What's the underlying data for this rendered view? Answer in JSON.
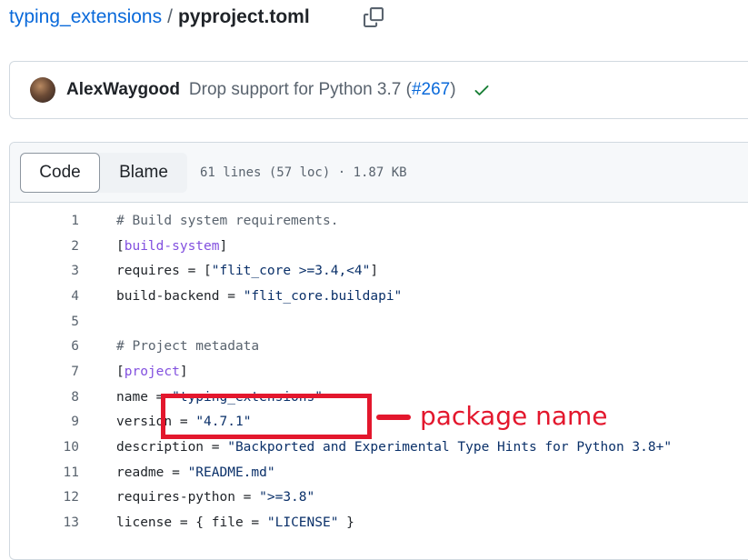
{
  "breadcrumb": {
    "repo": "typing_extensions",
    "separator": "/",
    "file": "pyproject.toml"
  },
  "commit": {
    "author": "AlexWaygood",
    "message": "Drop support for Python 3.7 (",
    "pr": "#267",
    "message_end": ")",
    "status_icon": "check-icon",
    "status_color": "#1a7f37"
  },
  "file_header": {
    "tab_code": "Code",
    "tab_blame": "Blame",
    "stats": "61 lines (57 loc) · 1.87 KB"
  },
  "code_lines": [
    {
      "num": "1",
      "parts": [
        {
          "t": "# Build system requirements.",
          "c": "cm"
        }
      ]
    },
    {
      "num": "2",
      "parts": [
        {
          "t": "[",
          "c": ""
        },
        {
          "t": "build-system",
          "c": "sec"
        },
        {
          "t": "]",
          "c": ""
        }
      ]
    },
    {
      "num": "3",
      "parts": [
        {
          "t": "requires = [",
          "c": ""
        },
        {
          "t": "\"flit_core >=3.4,<4\"",
          "c": "str"
        },
        {
          "t": "]",
          "c": ""
        }
      ]
    },
    {
      "num": "4",
      "parts": [
        {
          "t": "build-backend = ",
          "c": ""
        },
        {
          "t": "\"flit_core.buildapi\"",
          "c": "str"
        }
      ]
    },
    {
      "num": "5",
      "parts": []
    },
    {
      "num": "6",
      "parts": [
        {
          "t": "# Project metadata",
          "c": "cm"
        }
      ]
    },
    {
      "num": "7",
      "parts": [
        {
          "t": "[",
          "c": ""
        },
        {
          "t": "project",
          "c": "sec"
        },
        {
          "t": "]",
          "c": ""
        }
      ]
    },
    {
      "num": "8",
      "parts": [
        {
          "t": "name = ",
          "c": ""
        },
        {
          "t": "\"typing_extensions\"",
          "c": "str"
        }
      ]
    },
    {
      "num": "9",
      "parts": [
        {
          "t": "version = ",
          "c": ""
        },
        {
          "t": "\"4.7.1\"",
          "c": "str"
        }
      ]
    },
    {
      "num": "10",
      "parts": [
        {
          "t": "description = ",
          "c": ""
        },
        {
          "t": "\"Backported and Experimental Type Hints for Python 3.8+\"",
          "c": "str"
        }
      ]
    },
    {
      "num": "11",
      "parts": [
        {
          "t": "readme = ",
          "c": ""
        },
        {
          "t": "\"README.md\"",
          "c": "str"
        }
      ]
    },
    {
      "num": "12",
      "parts": [
        {
          "t": "requires-python = ",
          "c": ""
        },
        {
          "t": "\">=3.8\"",
          "c": "str"
        }
      ]
    },
    {
      "num": "13",
      "parts": [
        {
          "t": "license = { file = ",
          "c": ""
        },
        {
          "t": "\"LICENSE\"",
          "c": "str"
        },
        {
          "t": " }",
          "c": ""
        }
      ]
    }
  ],
  "annotation": {
    "label": "package name",
    "color": "#e3172d"
  }
}
